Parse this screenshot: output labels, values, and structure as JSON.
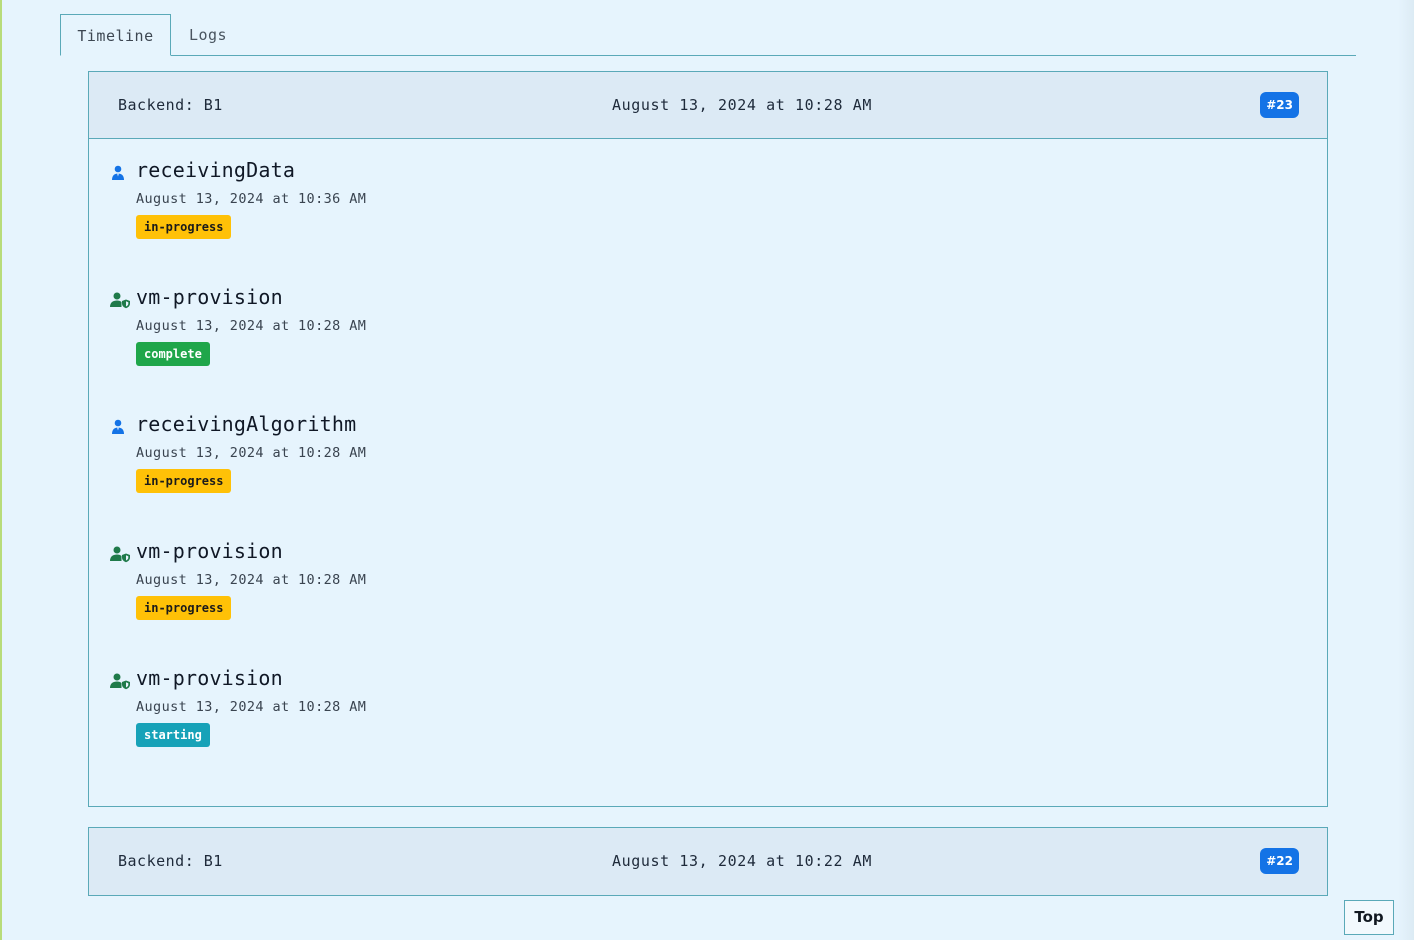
{
  "tabs": [
    {
      "label": "Timeline",
      "active": true
    },
    {
      "label": "Logs",
      "active": false
    }
  ],
  "cards": [
    {
      "backend": "Backend: B1",
      "date": "August 13, 2024 at 10:28 AM",
      "badge": "#23",
      "items": [
        {
          "title": "receivingData",
          "date": "August 13, 2024 at 10:36 AM",
          "status": "in-progress",
          "icon": "user-icon"
        },
        {
          "title": "vm-provision",
          "date": "August 13, 2024 at 10:28 AM",
          "status": "complete",
          "icon": "user-shield-icon"
        },
        {
          "title": "receivingAlgorithm",
          "date": "August 13, 2024 at 10:28 AM",
          "status": "in-progress",
          "icon": "user-icon"
        },
        {
          "title": "vm-provision",
          "date": "August 13, 2024 at 10:28 AM",
          "status": "in-progress",
          "icon": "user-shield-icon"
        },
        {
          "title": "vm-provision",
          "date": "August 13, 2024 at 10:28 AM",
          "status": "starting",
          "icon": "user-shield-icon"
        }
      ]
    },
    {
      "backend": "Backend: B1",
      "date": "August 13, 2024 at 10:22 AM",
      "badge": "#22",
      "items": []
    }
  ],
  "top_button": "Top",
  "colors": {
    "background": "#e6f4fd",
    "border": "#5aa9b8",
    "badge": "#1473e6",
    "in_progress": "#ffc107",
    "complete": "#1fa64a",
    "starting": "#17a2b8",
    "user_icon": "#1473e6",
    "user_shield_icon": "#1f7a4a"
  }
}
